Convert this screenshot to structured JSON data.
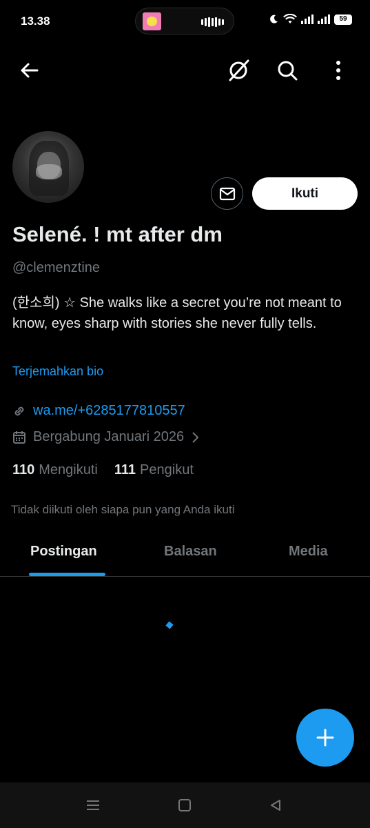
{
  "status_bar": {
    "time": "13.38",
    "battery": "59"
  },
  "top_nav": {
    "back_icon": "arrow-left-icon",
    "grok_icon": "grok-icon",
    "search_icon": "search-icon",
    "more_icon": "more-vertical-icon"
  },
  "profile": {
    "display_name": "Selené. ! mt after dm",
    "handle": "@clemenztine",
    "bio": "(한소희) ☆ She walks like a secret you’re not meant to know, eyes sharp with stories she never fully tells.",
    "translate_label": "Terjemahkan bio",
    "link": "wa.me/+6285177810557",
    "joined": "Bergabung Januari 2026",
    "following_count": "110",
    "following_label": "Mengikuti",
    "followers_count": "111",
    "followers_label": "Pengikut",
    "not_followed_text": "Tidak diikuti oleh siapa pun yang Anda ikuti",
    "follow_button": "Ikuti"
  },
  "tabs": [
    {
      "label": "Postingan",
      "active": true
    },
    {
      "label": "Balasan",
      "active": false
    },
    {
      "label": "Media",
      "active": false
    }
  ],
  "colors": {
    "accent": "#1d9bf0",
    "background": "#000000",
    "secondary_text": "#71767b"
  }
}
